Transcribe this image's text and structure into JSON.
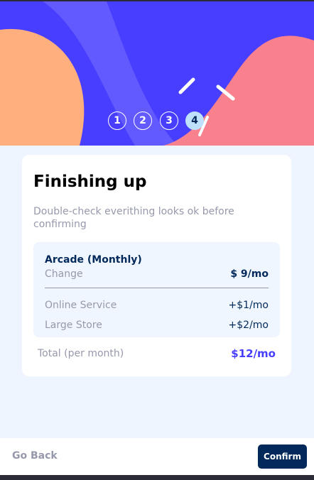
{
  "steps": [
    {
      "label": "1",
      "active": false
    },
    {
      "label": "2",
      "active": false
    },
    {
      "label": "3",
      "active": false
    },
    {
      "label": "4",
      "active": true
    }
  ],
  "summary": {
    "title": "Finishing up",
    "subtitle": "Double-check everithing looks ok before confirming",
    "plan": {
      "name": "Arcade (Monthly)",
      "change_label": "Change",
      "price": "$ 9/mo"
    },
    "addons": [
      {
        "name": "Online Service",
        "price": "+$1/mo"
      },
      {
        "name": "Large Store",
        "price": "+$2/mo"
      }
    ],
    "total": {
      "label": "Total (per month)",
      "price": "$12/mo"
    }
  },
  "footer": {
    "back_label": "Go Back",
    "confirm_label": "Confirm"
  },
  "colors": {
    "hero_bg": "#483eff",
    "hero_shape_left": "#ffaf7e",
    "hero_shape_right": "#f9818e",
    "hero_wave": "#6259ff",
    "active_step": "#bee2fd",
    "marine_blue": "#02295a",
    "purplish_blue": "#483eff",
    "cool_gray": "#9699ab",
    "magnolia": "#eff5ff",
    "alabaster": "#f0f6ff"
  }
}
